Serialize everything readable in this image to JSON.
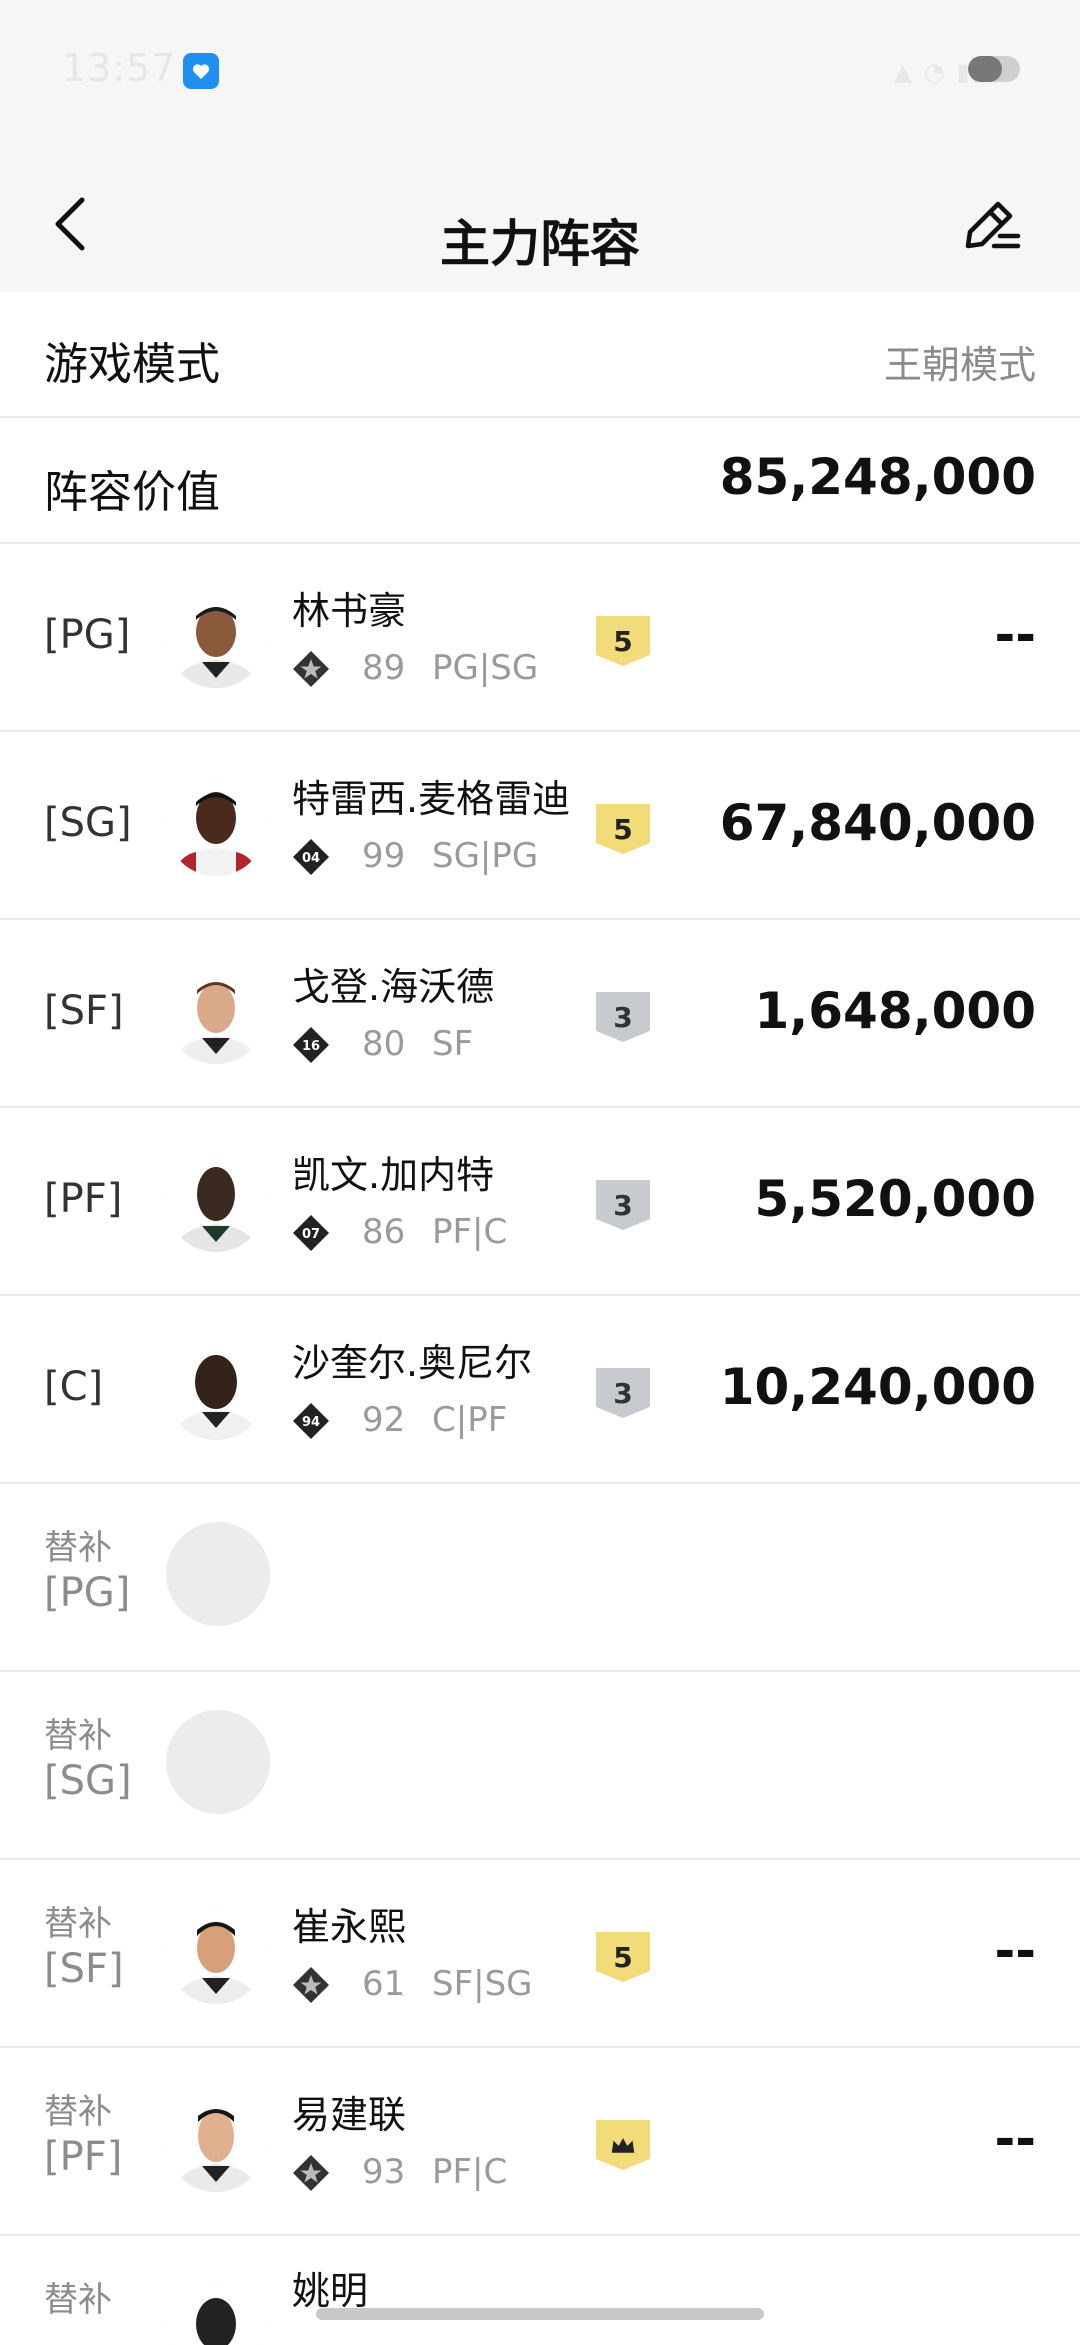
{
  "status": {
    "time": "13:57"
  },
  "header": {
    "title": "主力阵容"
  },
  "summary": [
    {
      "label": "游戏模式",
      "value": "王朝模式"
    },
    {
      "label": "阵容价值",
      "value": "85,248,000"
    }
  ],
  "starters": [
    {
      "pos": "[PG]",
      "name": "林书豪",
      "rank_badge": "",
      "rating": "89",
      "positions": "PG|SG",
      "tier": "5",
      "tier_style": "gold",
      "price": "--"
    },
    {
      "pos": "[SG]",
      "name": "特雷西.麦格雷迪",
      "rank_badge": "04",
      "rating": "99",
      "positions": "SG|PG",
      "tier": "5",
      "tier_style": "gold",
      "price": "67,840,000"
    },
    {
      "pos": "[SF]",
      "name": "戈登.海沃德",
      "rank_badge": "16",
      "rating": "80",
      "positions": "SF",
      "tier": "3",
      "tier_style": "silver",
      "price": "1,648,000"
    },
    {
      "pos": "[PF]",
      "name": "凯文.加内特",
      "rank_badge": "07",
      "rating": "86",
      "positions": "PF|C",
      "tier": "3",
      "tier_style": "silver",
      "price": "5,520,000"
    },
    {
      "pos": "[C]",
      "name": "沙奎尔.奥尼尔",
      "rank_badge": "94",
      "rating": "92",
      "positions": "C|PF",
      "tier": "3",
      "tier_style": "silver",
      "price": "10,240,000"
    }
  ],
  "bench": [
    {
      "label": "替补",
      "pos": "[PG]"
    },
    {
      "label": "替补",
      "pos": "[SG]"
    },
    {
      "label": "替补",
      "pos": "[SF]",
      "name": "崔永熙",
      "rating": "61",
      "positions": "SF|SG",
      "tier": "5",
      "price": "--"
    },
    {
      "label": "替补",
      "pos": "[PF]",
      "name": "易建联",
      "rating": "93",
      "positions": "PF|C",
      "tier": "crown",
      "price": "--"
    },
    {
      "label": "替补",
      "name": "姚明"
    }
  ],
  "colors": {
    "gold_tier": "#f2dc7a",
    "silver_tier": "#c7cbd0",
    "muted_text": "#8b8b8b"
  }
}
